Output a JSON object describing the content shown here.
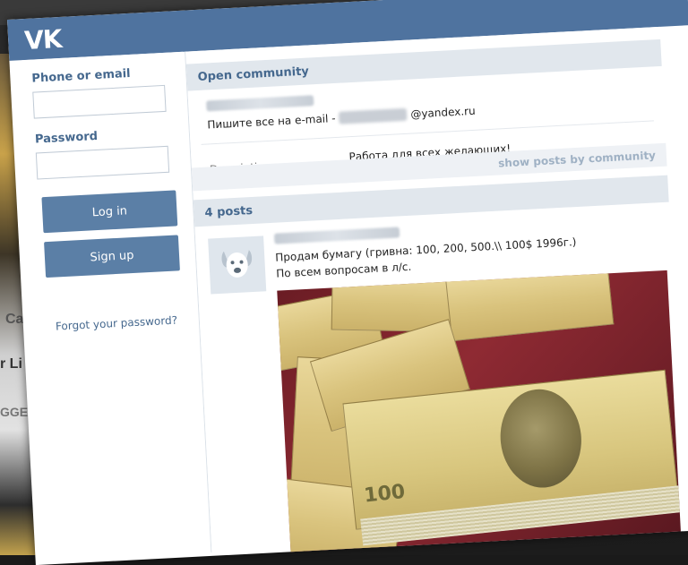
{
  "app": {
    "logo_text": "VK",
    "brand_color": "#4f739f"
  },
  "login": {
    "phone_label": "Phone or email",
    "phone_value": "",
    "password_label": "Password",
    "password_value": "",
    "login_button": "Log in",
    "signup_button": "Sign up",
    "forgot_link": "Forgot your password?"
  },
  "community": {
    "header": "Open community",
    "email_prefix": "Пишите все на e-mail -",
    "email_suffix": "@yandex.ru",
    "description_label": "Description:",
    "description_value": "Работа для всех желающих!",
    "show_posts_link": "show posts by community",
    "posts_count": "4 posts"
  },
  "post": {
    "text_line1": "Продам бумагу (гривна: 100, 200, 500.\\\\ 100$ 1996г.)",
    "text_line2": "По всем вопросам в л/с.",
    "image_note_value": "100",
    "avatar_icon": "dog-avatar-icon"
  },
  "backdrop": {
    "left_text1": "Ca",
    "left_text2": "r Li",
    "left_text3": "GGE"
  }
}
